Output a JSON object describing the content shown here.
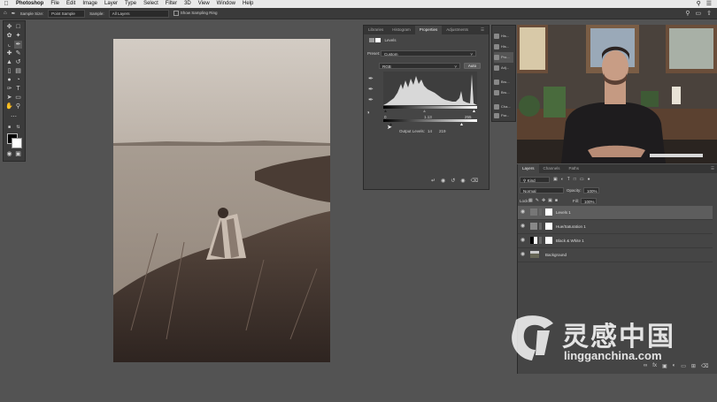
{
  "menubar": {
    "apple_icon": "apple-icon",
    "items": [
      "Photoshop",
      "File",
      "Edit",
      "Image",
      "Layer",
      "Type",
      "Select",
      "Filter",
      "3D",
      "View",
      "Window",
      "Help"
    ]
  },
  "options_bar": {
    "sample_size_label": "Sample Size:",
    "sample_size_value": "Point Sample",
    "sample_label": "Sample:",
    "sample_value": "All Layers",
    "show_ring_label": "Show Sampling Ring"
  },
  "properties": {
    "tabs": [
      "Libraries",
      "Histogram",
      "Properties",
      "Adjustments"
    ],
    "active_tab": "Properties",
    "panel_title": "Levels",
    "preset_label": "Preset:",
    "preset_value": "Custom",
    "channel_value": "RGB",
    "auto_label": "Auto",
    "input_black": "0",
    "input_mid": "1.13",
    "input_white": "255",
    "output_label": "Output Levels:",
    "output_black": "14",
    "output_white": "219"
  },
  "strip": {
    "items": [
      "His...",
      "His...",
      "Pro...",
      "Adj...",
      "Bru...",
      "Bru...",
      "Cha...",
      "Par..."
    ]
  },
  "layers": {
    "tabs": [
      "Layers",
      "Channels",
      "Paths"
    ],
    "active_tab": "Layers",
    "kind_label": "Kind",
    "blend_mode": "Normal",
    "opacity_label": "Opacity:",
    "opacity_value": "100%",
    "lock_label": "Lock:",
    "fill_label": "Fill:",
    "fill_value": "100%",
    "rows": [
      {
        "name": "Levels 1",
        "selected": true
      },
      {
        "name": "Hue/Saturation 1",
        "selected": false
      },
      {
        "name": "Black & White 1",
        "selected": false
      },
      {
        "name": "Background",
        "selected": false
      }
    ]
  },
  "watermark": {
    "cn_text": "灵感中国",
    "url_text": "lingganchina.com"
  },
  "colors": {
    "workspace": "#535353",
    "panel": "#454545",
    "panel_dark": "#353535",
    "selected_layer": "#5d5d5d"
  }
}
